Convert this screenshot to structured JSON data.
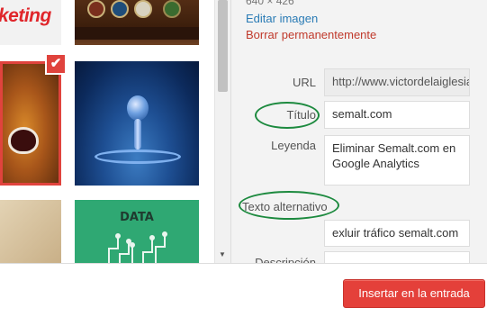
{
  "grid": {
    "thumb1_text": "keting",
    "thumb6_text": "DATA",
    "selected_check": "✔"
  },
  "sidebar": {
    "dimensions": "640 × 426",
    "edit_link": "Editar imagen",
    "delete_link": "Borrar permanentemente",
    "fields": {
      "url_label": "URL",
      "url_value": "http://www.victordelaiglesia.com",
      "title_label": "Título",
      "title_value": "semalt.com",
      "caption_label": "Leyenda",
      "caption_value": "Eliminar Semalt.com en Google Analytics",
      "alt_label": "Texto alternativo",
      "alt_value": "exluir tráfico semalt.com",
      "description_label": "Descripción"
    }
  },
  "footer": {
    "insert_button": "Insertar en la entrada"
  },
  "colors": {
    "accent": "#e4403a",
    "link": "#2a7bb5",
    "delete": "#c0392b",
    "annotation": "#1d8a3f"
  }
}
